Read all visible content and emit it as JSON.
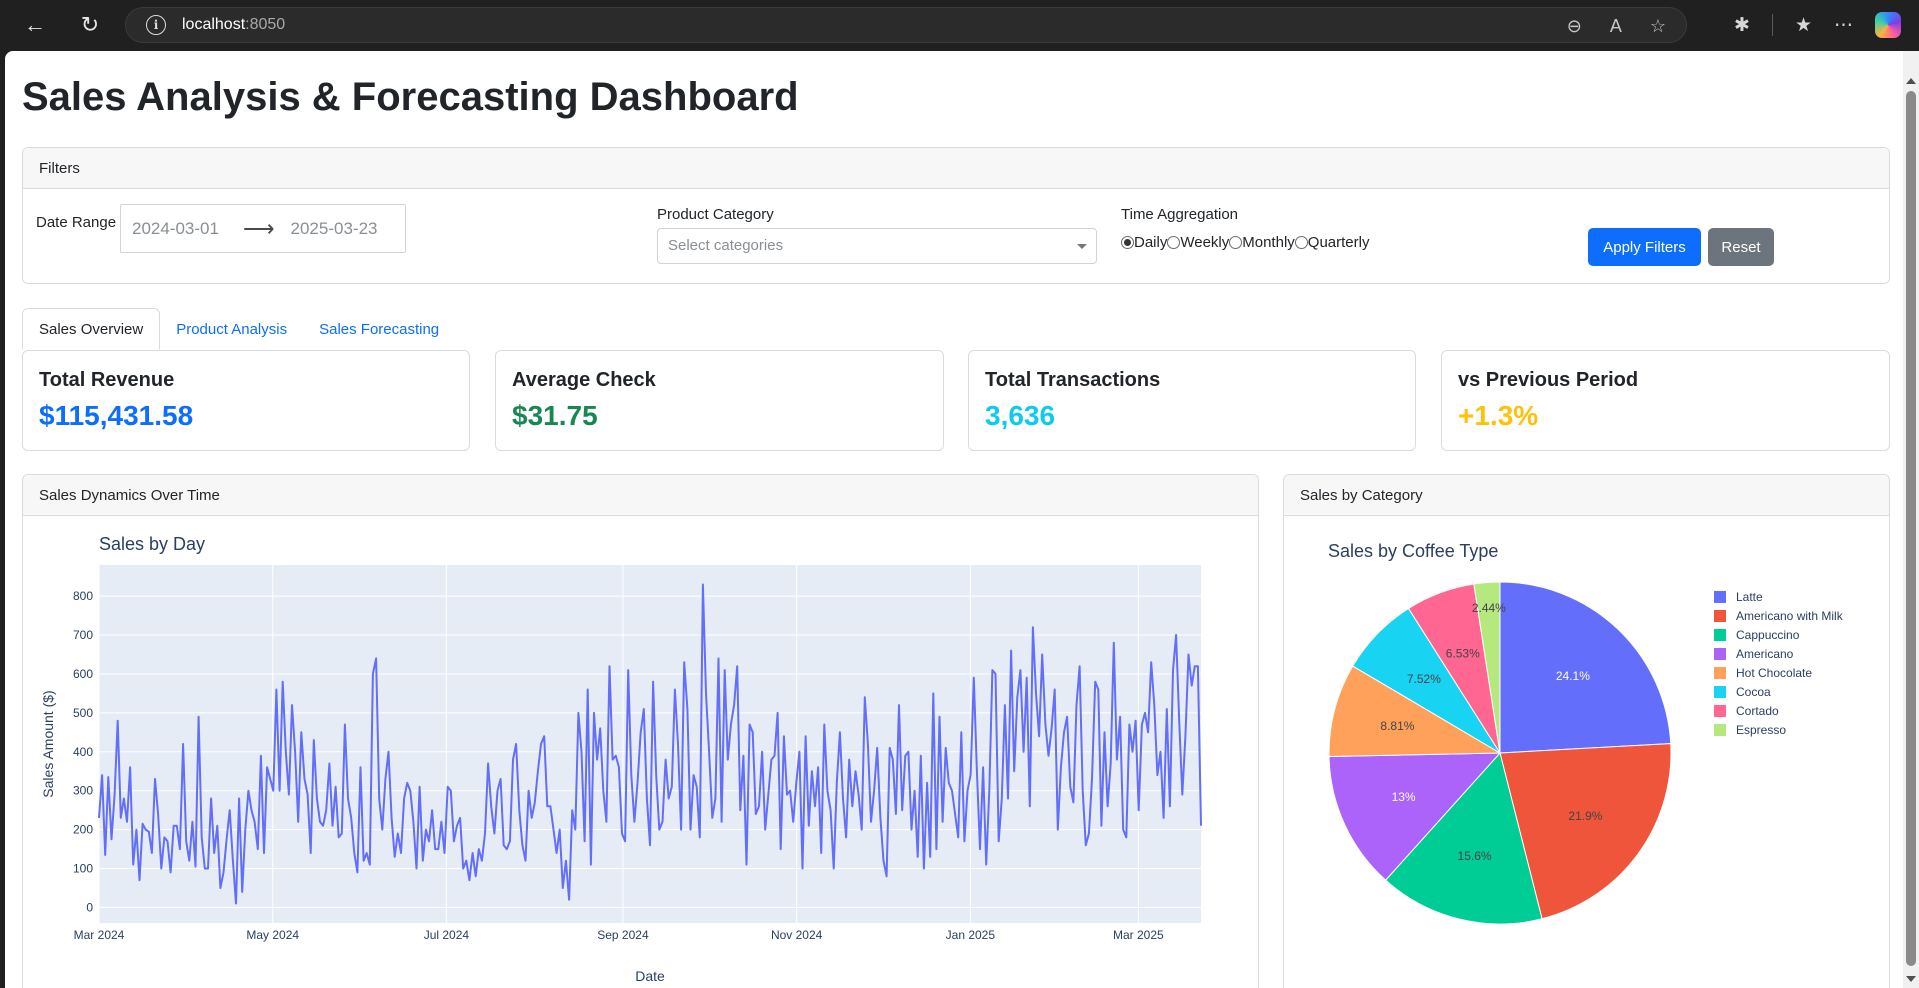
{
  "browser": {
    "url_host": "localhost",
    "url_port": ":8050"
  },
  "page": {
    "title": "Sales Analysis & Forecasting Dashboard"
  },
  "filters": {
    "header": "Filters",
    "date_range_label": "Date Range",
    "start_date": "2024-03-01",
    "end_date": "2025-03-23",
    "product_category_label": "Product Category",
    "product_category_placeholder": "Select categories",
    "time_aggregation_label": "Time Aggregation",
    "time_aggregation_options": [
      "Daily",
      "Weekly",
      "Monthly",
      "Quarterly"
    ],
    "time_aggregation_selected": "Daily",
    "apply_label": "Apply Filters",
    "reset_label": "Reset"
  },
  "tabs": [
    {
      "label": "Sales Overview",
      "active": true
    },
    {
      "label": "Product Analysis",
      "active": false
    },
    {
      "label": "Sales Forecasting",
      "active": false
    }
  ],
  "kpis": [
    {
      "title": "Total Revenue",
      "value": "$115,431.58",
      "color": "#0d6efd"
    },
    {
      "title": "Average Check",
      "value": "$31.75",
      "color": "#198754"
    },
    {
      "title": "Total Transactions",
      "value": "3,636",
      "color": "#0dcaf0"
    },
    {
      "title": "vs Previous Period",
      "value": "+1.3%",
      "color": "#ffc107"
    }
  ],
  "cards": {
    "sales_dynamics_header": "Sales Dynamics Over Time",
    "sales_category_header": "Sales by Category"
  },
  "chart_data": [
    {
      "type": "line",
      "title": "Sales by Day",
      "xlabel": "Date",
      "ylabel": "Sales Amount ($)",
      "ylim": [
        0,
        850
      ],
      "yticks": [
        0,
        100,
        200,
        300,
        400,
        500,
        600,
        700,
        800
      ],
      "xticks": [
        "Mar 2024",
        "May 2024",
        "Jul 2024",
        "Sep 2024",
        "Nov 2024",
        "Jan 2025",
        "Mar 2025"
      ],
      "x_range": [
        "2024-03-01",
        "2025-03-23"
      ],
      "grid": true,
      "color": "#636efa",
      "values": [
        230,
        340,
        135,
        335,
        175,
        290,
        480,
        230,
        280,
        220,
        360,
        110,
        200,
        70,
        215,
        200,
        195,
        140,
        330,
        240,
        100,
        180,
        170,
        90,
        210,
        210,
        150,
        420,
        170,
        120,
        220,
        105,
        490,
        180,
        100,
        100,
        280,
        140,
        210,
        50,
        90,
        175,
        250,
        120,
        10,
        280,
        40,
        200,
        300,
        250,
        220,
        150,
        390,
        140,
        360,
        330,
        300,
        560,
        300,
        580,
        400,
        290,
        520,
        400,
        220,
        450,
        330,
        290,
        140,
        430,
        280,
        220,
        210,
        250,
        370,
        210,
        310,
        180,
        190,
        470,
        280,
        230,
        140,
        90,
        360,
        120,
        140,
        110,
        600,
        640,
        280,
        200,
        330,
        400,
        230,
        130,
        190,
        140,
        280,
        320,
        300,
        220,
        100,
        310,
        120,
        200,
        170,
        250,
        150,
        150,
        220,
        140,
        310,
        300,
        170,
        210,
        230,
        100,
        120,
        70,
        140,
        80,
        150,
        120,
        190,
        370,
        260,
        190,
        300,
        330,
        160,
        150,
        170,
        380,
        420,
        250,
        160,
        120,
        300,
        230,
        270,
        350,
        420,
        440,
        260,
        260,
        200,
        140,
        200,
        50,
        120,
        20,
        250,
        200,
        500,
        400,
        170,
        560,
        110,
        500,
        380,
        460,
        300,
        220,
        620,
        380,
        390,
        360,
        190,
        170,
        610,
        340,
        220,
        320,
        450,
        510,
        280,
        160,
        580,
        340,
        200,
        220,
        380,
        280,
        310,
        560,
        420,
        200,
        630,
        510,
        200,
        340,
        310,
        180,
        830,
        550,
        400,
        230,
        280,
        640,
        220,
        610,
        380,
        470,
        520,
        620,
        250,
        390,
        110,
        470,
        450,
        240,
        260,
        400,
        200,
        290,
        380,
        390,
        500,
        150,
        440,
        290,
        300,
        220,
        320,
        400,
        100,
        440,
        210,
        350,
        260,
        360,
        140,
        470,
        300,
        250,
        100,
        320,
        450,
        280,
        180,
        380,
        260,
        350,
        290,
        200,
        540,
        420,
        220,
        300,
        410,
        230,
        120,
        80,
        410,
        380,
        240,
        520,
        250,
        390,
        400,
        200,
        300,
        130,
        390,
        100,
        320,
        130,
        550,
        150,
        490,
        220,
        410,
        320,
        300,
        240,
        180,
        450,
        170,
        300,
        340,
        590,
        350,
        150,
        360,
        110,
        300,
        610,
        600,
        170,
        280,
        520,
        280,
        660,
        350,
        540,
        610,
        400,
        590,
        260,
        720,
        550,
        440,
        650,
        470,
        390,
        460,
        560,
        200,
        360,
        450,
        490,
        310,
        270,
        520,
        620,
        300,
        160,
        190,
        330,
        580,
        560,
        210,
        450,
        260,
        370,
        680,
        380,
        490,
        200,
        180,
        470,
        400,
        480,
        250,
        470,
        500,
        450,
        630,
        520,
        340,
        400,
        230,
        510,
        260,
        610,
        700,
        480,
        290,
        440,
        650,
        570,
        620,
        620,
        210
      ]
    },
    {
      "type": "pie",
      "title": "Sales by Coffee Type",
      "legend_position": "right",
      "slices": [
        {
          "label": "Latte",
          "value": 24.1,
          "text": "24.1%",
          "color": "#636efa"
        },
        {
          "label": "Americano with Milk",
          "value": 21.9,
          "text": "21.9%",
          "color": "#ef553b"
        },
        {
          "label": "Cappuccino",
          "value": 15.6,
          "text": "15.6%",
          "color": "#00cc96"
        },
        {
          "label": "Americano",
          "value": 13.0,
          "text": "13%",
          "color": "#ab63fa"
        },
        {
          "label": "Hot Chocolate",
          "value": 8.81,
          "text": "8.81%",
          "color": "#ffa15a"
        },
        {
          "label": "Cocoa",
          "value": 7.52,
          "text": "7.52%",
          "color": "#19d3f3"
        },
        {
          "label": "Cortado",
          "value": 6.53,
          "text": "6.53%",
          "color": "#ff6692"
        },
        {
          "label": "Espresso",
          "value": 2.44,
          "text": "2.44%",
          "color": "#b6e880"
        }
      ]
    }
  ]
}
